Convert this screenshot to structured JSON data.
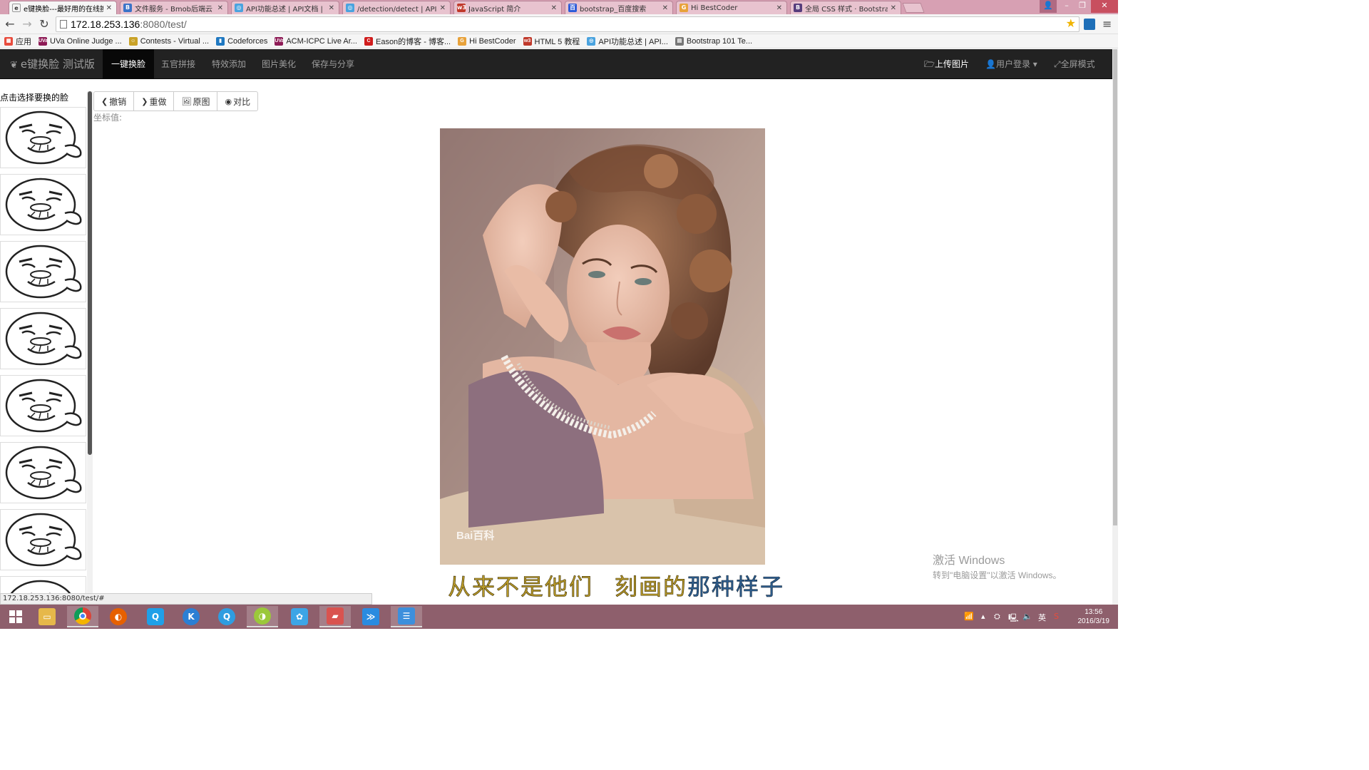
{
  "browser": {
    "tabs": [
      {
        "title": "e键换脸---最好用的在线换",
        "favicon_color": "#f4f4f4",
        "favicon_text": "e",
        "active": true
      },
      {
        "title": "文件服务 - Bmob后端云",
        "favicon_color": "#3b73c8",
        "favicon_text": "B",
        "active": false
      },
      {
        "title": "API功能总述 | API文档 | F",
        "favicon_color": "#4aa3df",
        "favicon_text": "◎",
        "active": false
      },
      {
        "title": "/detection/detect | API文",
        "favicon_color": "#4aa3df",
        "favicon_text": "◎",
        "active": false
      },
      {
        "title": "JavaScript 简介",
        "favicon_color": "#c0392b",
        "favicon_text": "w3",
        "active": false
      },
      {
        "title": "bootstrap_百度搜索",
        "favicon_color": "#2d5bd8",
        "favicon_text": "百",
        "active": false
      },
      {
        "title": "Hi BestCoder",
        "favicon_color": "#e8a23b",
        "favicon_text": "G",
        "active": false
      },
      {
        "title": "全局 CSS 样式 · Bootstra",
        "favicon_color": "#563d7c",
        "favicon_text": "B",
        "active": false
      }
    ],
    "url_host": "172.18.253.136",
    "url_rest": ":8080/test/",
    "bookmarks": [
      {
        "label": "应用",
        "color": "#e84c3d",
        "icon": "apps-icon"
      },
      {
        "label": "UVa Online Judge ...",
        "color": "#8e1b56",
        "icon": "uva-icon"
      },
      {
        "label": "Contests - Virtual ...",
        "color": "#c9a227",
        "icon": "vjudge-icon"
      },
      {
        "label": "Codeforces",
        "color": "#1f78c1",
        "icon": "codeforces-icon"
      },
      {
        "label": "ACM-ICPC Live Ar...",
        "color": "#8e1b56",
        "icon": "uva-icon"
      },
      {
        "label": "Eason的博客 - 博客...",
        "color": "#d01c1c",
        "icon": "csdn-icon"
      },
      {
        "label": "Hi BestCoder",
        "color": "#e8a23b",
        "icon": "bestcoder-icon"
      },
      {
        "label": "HTML 5 教程",
        "color": "#c0392b",
        "icon": "w3-icon"
      },
      {
        "label": "API功能总述 | API...",
        "color": "#4aa3df",
        "icon": "faceplusplus-icon"
      },
      {
        "label": "Bootstrap 101 Te...",
        "color": "#777777",
        "icon": "page-icon"
      }
    ]
  },
  "app": {
    "brand": "e键换脸 测试版",
    "nav": [
      {
        "label": "一键换脸",
        "active": true
      },
      {
        "label": "五官拼接",
        "active": false
      },
      {
        "label": "特效添加",
        "active": false
      },
      {
        "label": "图片美化",
        "active": false
      },
      {
        "label": "保存与分享",
        "active": false
      }
    ],
    "nav_right": {
      "upload": "上传图片",
      "login": "用户登录",
      "fullscreen": "全屏模式"
    },
    "sidebar_heading": "点击选择要换的脸",
    "toolbar": {
      "undo": "撤销",
      "redo": "重做",
      "original": "原图",
      "compare": "对比"
    },
    "coord_label": "坐标值:",
    "photo_watermark": "Bai百科",
    "caption": {
      "part1": "从来不是他们",
      "part2": "刻画的",
      "part3": "那种样子"
    }
  },
  "status_url": "172.18.253.136:8080/test/#",
  "windows": {
    "activate_title": "激活 Windows",
    "activate_sub": "转到\"电脑设置\"以激活 Windows。",
    "time": "13:56",
    "date": "2016/3/19",
    "ime": "英"
  },
  "colors": {
    "navbar_bg": "#222222",
    "taskbar_bg": "#8e5f6c",
    "tabbar_bg": "#d7a0b3"
  }
}
